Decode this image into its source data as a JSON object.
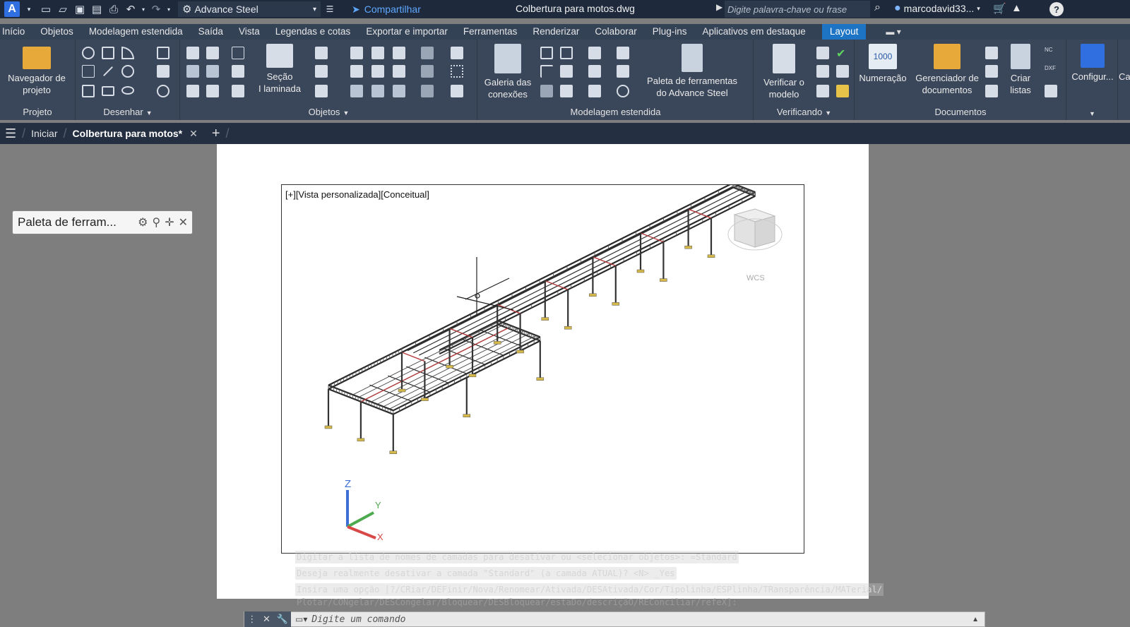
{
  "titlebar": {
    "app_logo": "A",
    "workspace": "Advance Steel",
    "share": "Compartilhar",
    "document_title": "Colbertura para motos.dwg",
    "search_placeholder": "Digite palavra-chave ou frase",
    "user": "marcodavid33..."
  },
  "tabs": [
    "Início",
    "Objetos",
    "Modelagem estendida",
    "Saída",
    "Vista",
    "Legendas e cotas",
    "Exportar e importar",
    "Ferramentas",
    "Renderizar",
    "Colaborar",
    "Plug-ins",
    "Aplicativos em destaque"
  ],
  "active_tab": "Layout",
  "ribbon": {
    "projeto": {
      "title": "Projeto",
      "nav_line1": "Navegador de",
      "nav_line2": "projeto"
    },
    "desenhar": {
      "title": "Desenhar"
    },
    "objetos": {
      "title": "Objetos",
      "secao_line1": "Seção",
      "secao_line2": "I laminada"
    },
    "modelagem": {
      "title": "Modelagem estendida",
      "galeria_line1": "Galeria das",
      "galeria_line2": "conexões",
      "paleta_line1": "Paleta de ferramentas",
      "paleta_line2": "do Advance Steel"
    },
    "verificando": {
      "title": "Verificando",
      "verificar_line1": "Verificar o",
      "verificar_line2": "modelo"
    },
    "documentos": {
      "title": "Documentos",
      "numeracao": "Numeração",
      "numeracao_icon_text": "1000",
      "gerenciador_line1": "Gerenciador de",
      "gerenciador_line2": "documentos",
      "criar_line1": "Criar",
      "criar_line2": "listas"
    },
    "extra": {
      "config": "Configur...",
      "ca": "Ca",
      "nc": "NC",
      "dxf": "DXF"
    }
  },
  "doctabs": {
    "start": "Iniciar",
    "active": "Colbertura para motos*"
  },
  "viewport": {
    "label": "[+][Vista personalizada][Conceitual]",
    "axis_x": "X",
    "axis_y": "Y",
    "axis_z": "Z",
    "wcs": "WCS"
  },
  "palette": {
    "title": "Paleta de ferram..."
  },
  "command_history": [
    "Digitar a lista de nomes de camadas para desativar ou <selecionar objetos>: =Standard",
    "Deseja realmente desativar a camada \"Standard\" (a camada ATUAL)? <N> _Yes",
    "Insira uma opção [?/CRiar/DEFinir/Nova/Renomear/Ativada/DESAtivada/Cor/Tipolinha/ESPlinha/TRansparência/MATerial/",
    "Plotar/CONgelar/DESCongelar/Bloquear/DESBloquear/estaDo/descriçãO/REConciliar/refeX]:"
  ],
  "command_input_placeholder": "Digite um comando",
  "colors": {
    "titlebar": "#1e2a3c",
    "ribbon": "#3a4659",
    "accent": "#1d74c4",
    "share": "#5ea7ff"
  }
}
